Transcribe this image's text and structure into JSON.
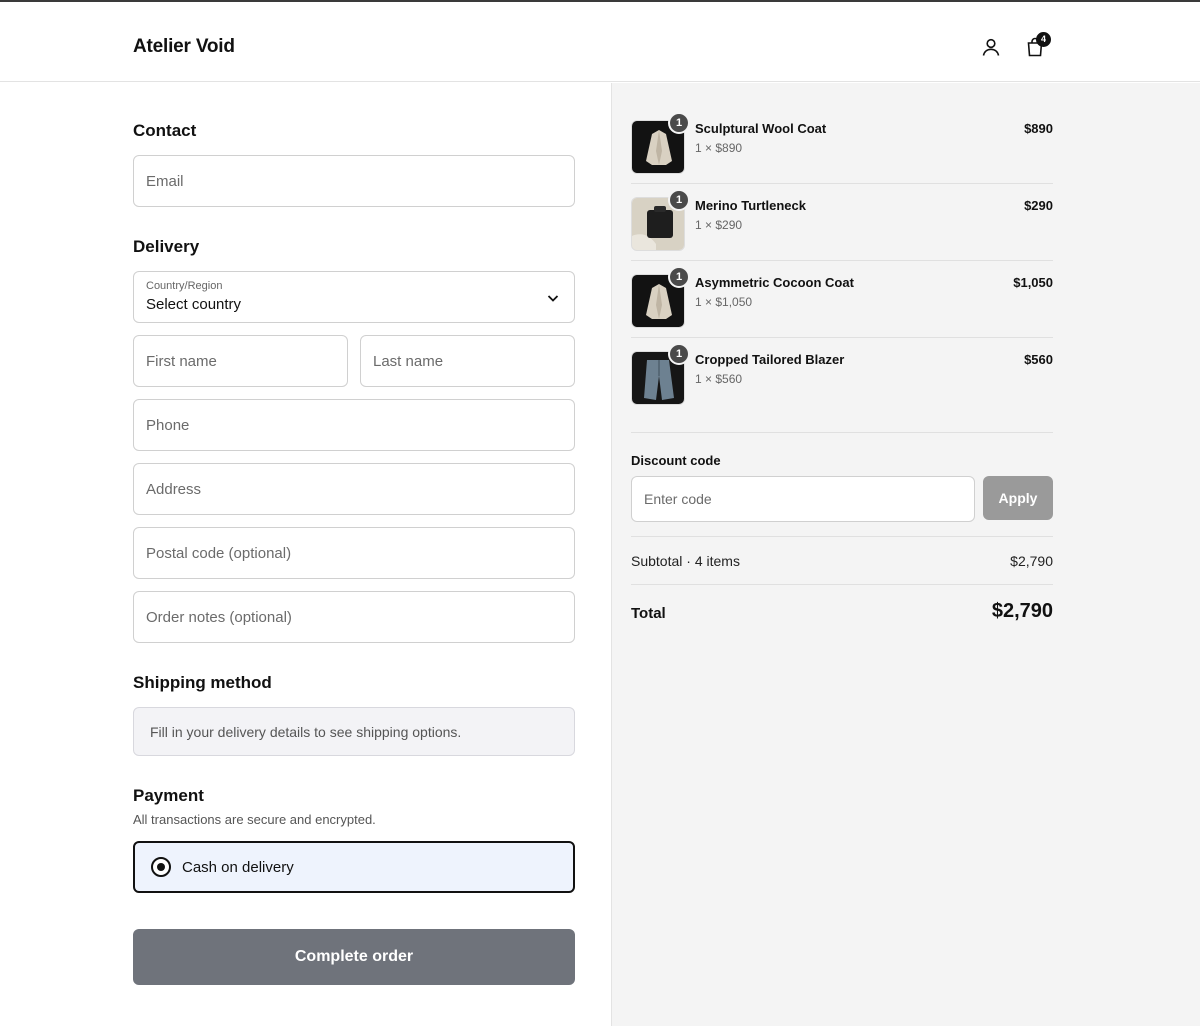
{
  "header": {
    "brand": "Atelier Void",
    "cart_count": "4",
    "icons": [
      "user-icon",
      "shopping-bag-icon"
    ]
  },
  "contact": {
    "title": "Contact",
    "email_placeholder": "Email"
  },
  "delivery": {
    "title": "Delivery",
    "country_label": "Country/Region",
    "country_value": "Select country",
    "first_name_placeholder": "First name",
    "last_name_placeholder": "Last name",
    "phone_placeholder": "Phone",
    "address_placeholder": "Address",
    "postal_placeholder": "Postal code (optional)",
    "notes_placeholder": "Order notes (optional)"
  },
  "shipping": {
    "title": "Shipping method",
    "message": "Fill in your delivery details to see shipping options."
  },
  "payment": {
    "title": "Payment",
    "subtitle": "All transactions are secure and encrypted.",
    "option_label": "Cash on delivery",
    "selected": true
  },
  "complete_label": "Complete order",
  "items": [
    {
      "name": "Sculptural Wool Coat",
      "qty": "1",
      "detail": "1 × $890",
      "price": "$890",
      "image": "coat-light-on-dark"
    },
    {
      "name": "Merino Turtleneck",
      "qty": "1",
      "detail": "1 × $290",
      "price": "$290",
      "image": "black-knit-on-beige"
    },
    {
      "name": "Asymmetric Cocoon Coat",
      "qty": "1",
      "detail": "1 × $1,050",
      "price": "$1,050",
      "image": "coat-light-on-dark"
    },
    {
      "name": "Cropped Tailored Blazer",
      "qty": "1",
      "detail": "1 × $560",
      "price": "$560",
      "image": "blue-garment-on-dark"
    }
  ],
  "discount": {
    "label": "Discount code",
    "placeholder": "Enter code",
    "apply_label": "Apply"
  },
  "summary": {
    "subtotal_label": "Subtotal · 4 items",
    "subtotal_value": "$2,790",
    "total_label": "Total",
    "total_value": "$2,790"
  },
  "colors": {
    "primary_button": "#6f737b",
    "apply_button": "#9a9a9a",
    "payment_bg": "#eef3fd",
    "summary_bg": "#f4f4f4"
  }
}
